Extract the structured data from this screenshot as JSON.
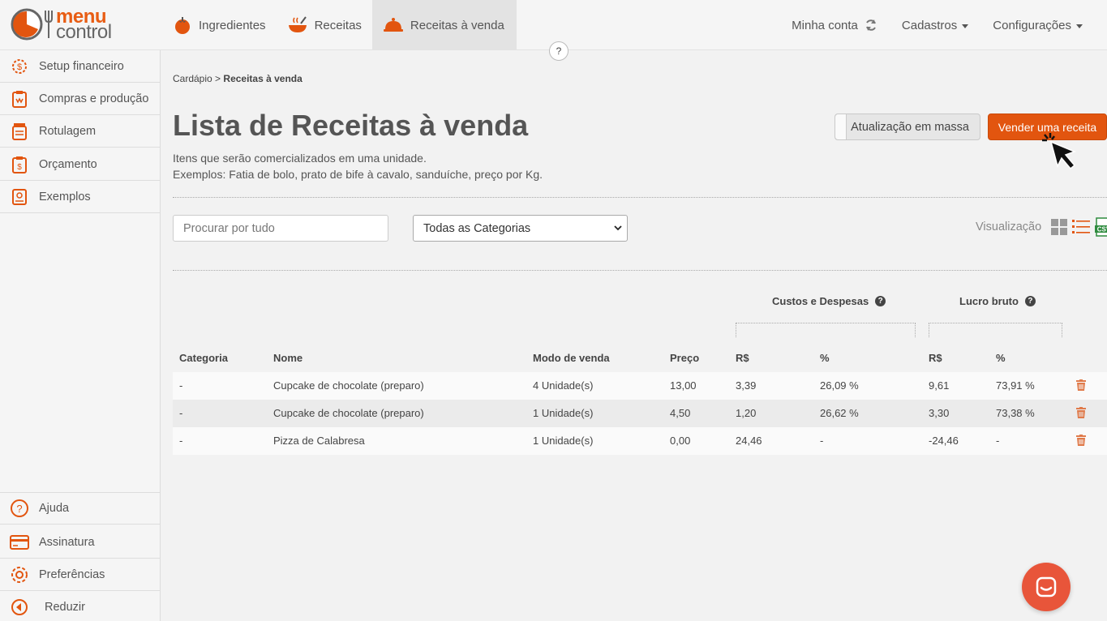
{
  "brand": {
    "line1": "menu",
    "line2": "control",
    "accent": "#e2550f"
  },
  "nav": {
    "items": [
      {
        "label": "Ingredientes",
        "icon": "tomato-icon"
      },
      {
        "label": "Receitas",
        "icon": "bowl-icon"
      },
      {
        "label": "Receitas à venda",
        "icon": "cloche-icon"
      }
    ],
    "help": "?",
    "account": "Minha conta",
    "cadastros": "Cadastros",
    "config": "Configurações"
  },
  "sidebar": {
    "top": [
      {
        "label": "Setup financeiro",
        "icon": "dollar-gear-icon"
      },
      {
        "label": "Compras e produção",
        "icon": "clipboard-icon"
      },
      {
        "label": "Rotulagem",
        "icon": "jar-icon"
      },
      {
        "label": "Orçamento",
        "icon": "budget-clipboard-icon"
      },
      {
        "label": "Exemplos",
        "icon": "example-icon"
      }
    ],
    "bottom": [
      {
        "label": "Ajuda",
        "icon": "help-icon"
      },
      {
        "label": "Assinatura",
        "icon": "card-icon"
      },
      {
        "label": "Preferências",
        "icon": "gear-icon"
      },
      {
        "label": "Reduzir",
        "icon": "collapse-icon"
      }
    ]
  },
  "breadcrumb": {
    "parent": "Cardápio",
    "sep": ">",
    "current": "Receitas à venda"
  },
  "page": {
    "title": "Lista de Receitas à venda",
    "subtitle1": "Itens que serão comercializados em uma unidade.",
    "subtitle2": "Exemplos: Fatia de bolo, prato de bife à cavalo, sanduíche, preço por Kg."
  },
  "actions": {
    "mass_update": "Atualização em massa",
    "sell_recipe": "Vender uma receita"
  },
  "filters": {
    "search_placeholder": "Procurar por tudo",
    "category": "Todas as Categorias"
  },
  "view": {
    "label": "Visualização",
    "csv": "CSV"
  },
  "table": {
    "group_costs": "Custos e Despesas",
    "group_profit": "Lucro bruto",
    "headers": {
      "categoria": "Categoria",
      "nome": "Nome",
      "modo": "Modo de venda",
      "preco": "Preço",
      "custo_rs": "R$",
      "custo_pct": "%",
      "lucro_rs": "R$",
      "lucro_pct": "%"
    },
    "rows": [
      {
        "categoria": "-",
        "nome": "Cupcake de chocolate (preparo)",
        "modo": "4 Unidade(s)",
        "preco": "13,00",
        "custo_rs": "3,39",
        "custo_pct": "26,09 %",
        "lucro_rs": "9,61",
        "lucro_pct": "73,91 %"
      },
      {
        "categoria": "-",
        "nome": "Cupcake de chocolate (preparo)",
        "modo": "1 Unidade(s)",
        "preco": "4,50",
        "custo_rs": "1,20",
        "custo_pct": "26,62 %",
        "lucro_rs": "3,30",
        "lucro_pct": "73,38 %"
      },
      {
        "categoria": "-",
        "nome": "Pizza de Calabresa",
        "modo": "1 Unidade(s)",
        "preco": "0,00",
        "custo_rs": "24,46",
        "custo_pct": "-",
        "lucro_rs": "-24,46",
        "lucro_pct": "-"
      }
    ]
  }
}
